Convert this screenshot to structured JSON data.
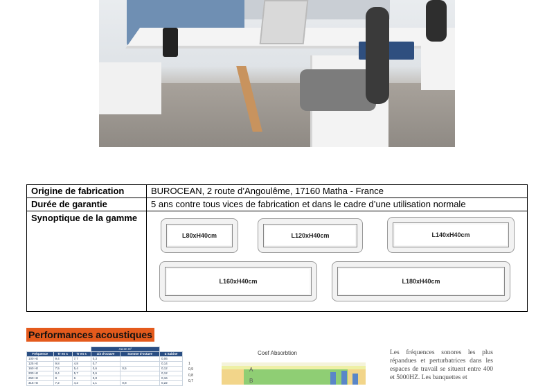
{
  "info_table": {
    "rows": [
      {
        "label": "Origine de fabrication",
        "value": "BUROCEAN, 2 route d’Angoulême, 17160 Matha - France"
      },
      {
        "label": "Durée de garantie",
        "value": "5 ans contre tous vices de fabrication et dans le cadre d’une utilisation normale"
      },
      {
        "label": "Synoptique de la gamme",
        "value": ""
      }
    ],
    "sizes": [
      "L80xH40cm",
      "L120xH40cm",
      "L140xH40cm",
      "L160xH40cm",
      "L180xH40cm"
    ]
  },
  "acoustic": {
    "title": "Performances acoustiques",
    "table": {
      "span_header": "Aα en m²",
      "headers": [
        "Fréquence",
        "Tr en s",
        "Tr en s",
        "1/3 d’octave",
        "Somme d’octave",
        "α Sabine"
      ],
      "rows": [
        [
          "100 Hz",
          "9,4",
          "7,7",
          "0,3",
          "",
          "0,06"
        ],
        [
          "125 Hz",
          "9,8",
          "4,8",
          "0,7",
          "",
          "0,14"
        ],
        [
          "160 Hz",
          "7,5",
          "5,4",
          "0,6",
          "0,5",
          "0,12"
        ],
        [
          "200 Hz",
          "8,4",
          "5,7",
          "0,6",
          "",
          "0,12"
        ],
        [
          "250 Hz",
          "8",
          "6",
          "0,8",
          "",
          "0,16"
        ],
        [
          "315 Hz",
          "7,2",
          "4,2",
          "1,1",
          "0,8",
          "0,22"
        ]
      ]
    },
    "chart": {
      "title": "Coef Absorbtion",
      "y_ticks": [
        "1",
        "0,9",
        "0,8",
        "0,7"
      ],
      "class_labels": [
        "A",
        "B"
      ]
    },
    "paragraph": "Les fréquences sonores les plus répandues et perturbatrices dans les espaces de travail se situent entre 400 et 5000HZ. Les banquettes et"
  }
}
